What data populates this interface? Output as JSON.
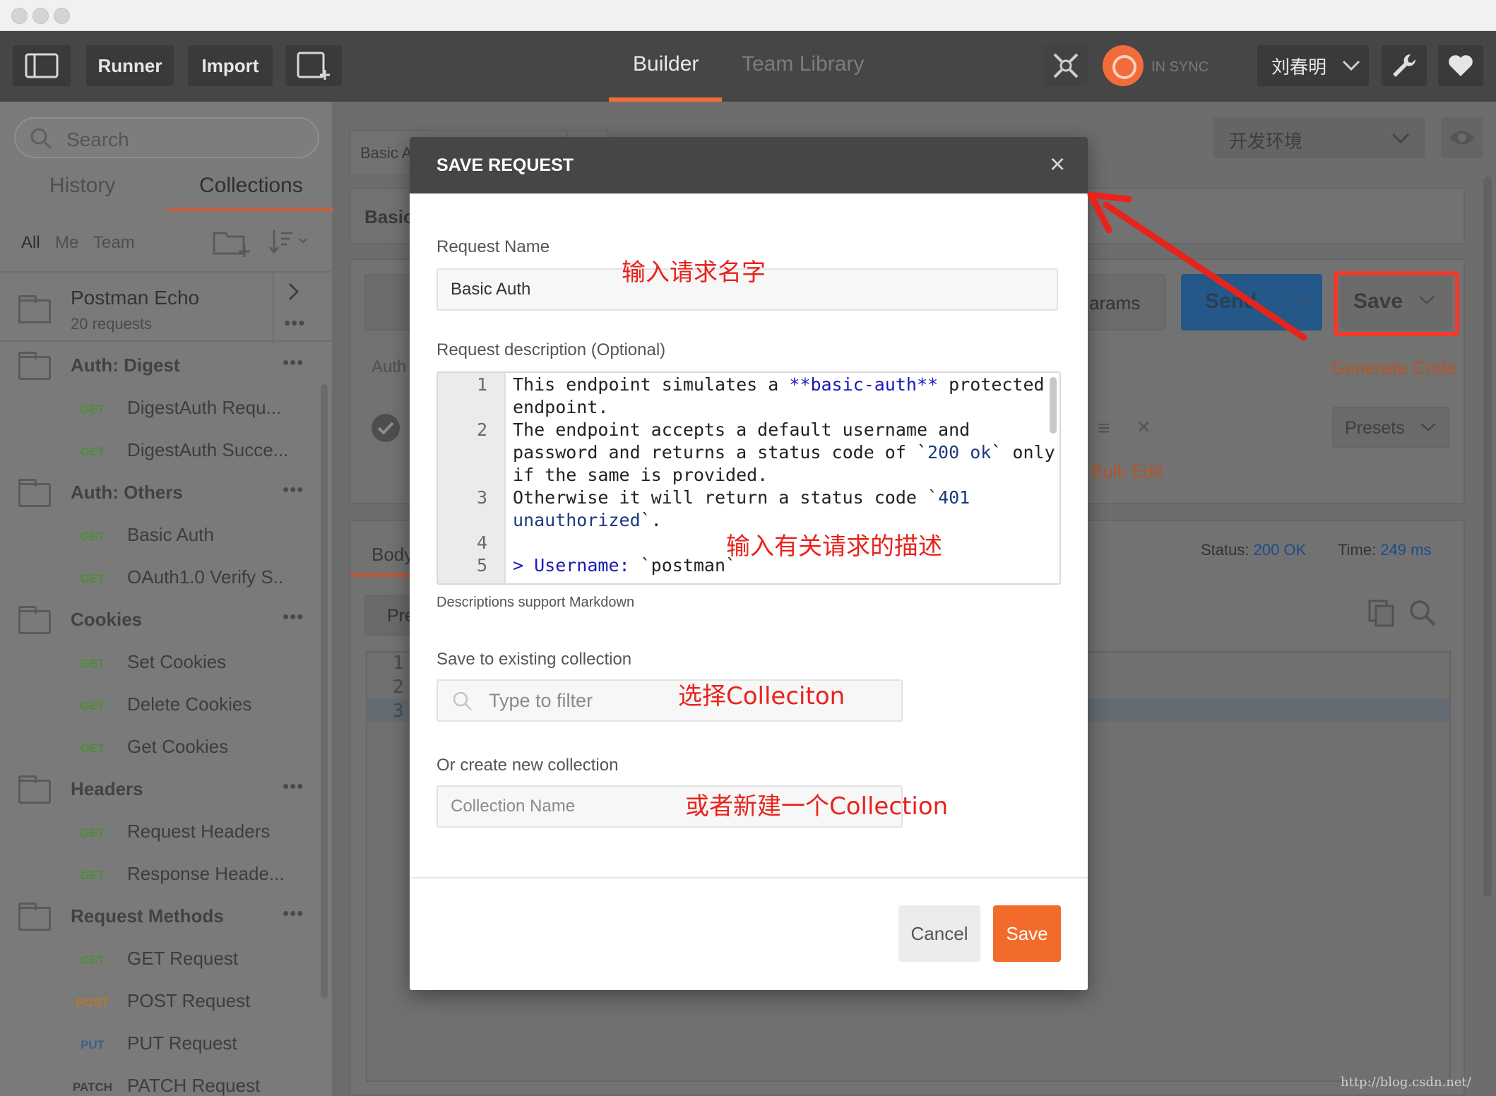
{
  "toolbar": {
    "runner_label": "Runner",
    "import_label": "Import",
    "tab_builder": "Builder",
    "tab_team_library": "Team Library",
    "sync_label": "IN SYNC",
    "user_name": "刘春明"
  },
  "sidebar": {
    "search_placeholder": "Search",
    "tab_history": "History",
    "tab_collections": "Collections",
    "filter_all": "All",
    "filter_me": "Me",
    "filter_team": "Team",
    "top_collection": {
      "name": "Postman Echo",
      "count": "20 requests"
    },
    "folders": [
      {
        "name": "Auth: Digest",
        "requests": [
          {
            "method": "GET",
            "name": "DigestAuth Requ..."
          },
          {
            "method": "GET",
            "name": "DigestAuth Succe..."
          }
        ]
      },
      {
        "name": "Auth: Others",
        "requests": [
          {
            "method": "GET",
            "name": "Basic Auth"
          },
          {
            "method": "GET",
            "name": "OAuth1.0 Verify S.."
          }
        ]
      },
      {
        "name": "Cookies",
        "requests": [
          {
            "method": "GET",
            "name": "Set Cookies"
          },
          {
            "method": "GET",
            "name": "Delete Cookies"
          },
          {
            "method": "GET",
            "name": "Get Cookies"
          }
        ]
      },
      {
        "name": "Headers",
        "requests": [
          {
            "method": "GET",
            "name": "Request Headers"
          },
          {
            "method": "GET",
            "name": "Response Heade..."
          }
        ]
      },
      {
        "name": "Request Methods",
        "requests": [
          {
            "method": "GET",
            "name": "GET Request"
          },
          {
            "method": "POST",
            "name": "POST Request"
          },
          {
            "method": "PUT",
            "name": "PUT Request"
          },
          {
            "method": "PATCH",
            "name": "PATCH Request"
          }
        ]
      }
    ]
  },
  "main": {
    "request_tab": "Basic A",
    "request_title": "Basic",
    "environment": "开发环境",
    "params_label": "arams",
    "auth_label": "Auth",
    "send_label": "Send",
    "save_label": "Save",
    "generate_code": "Generate Code",
    "presets": "Presets",
    "bulk_edit": "Bulk Edit",
    "body_label": "Body",
    "pretty_label": "Pre",
    "status_label": "Status:",
    "status_value": "200 OK",
    "time_label": "Time:",
    "time_value": "249 ms",
    "line_numbers": [
      "1",
      "2",
      "3"
    ],
    "watermark": "http://blog.csdn.net/"
  },
  "modal": {
    "title": "SAVE REQUEST",
    "close_glyph": "×",
    "request_name_label": "Request Name",
    "request_name_value": "Basic Auth",
    "description_label": "Request description (Optional)",
    "description_lines": [
      {
        "num": "1",
        "prefix": "This endpoint simulates a ",
        "bold": "**basic-auth**",
        "suffix": " protected"
      },
      {
        "num": "",
        "text": "endpoint."
      },
      {
        "num": "2",
        "text": "The endpoint accepts a default username and"
      },
      {
        "num": "",
        "prefix": "password and returns a status code of `",
        "code": "200 ok",
        "suffix": "` only"
      },
      {
        "num": "",
        "text": "if the same is provided."
      },
      {
        "num": "3",
        "prefix": "Otherwise it will return a status code `",
        "code": "401"
      },
      {
        "num": "",
        "code": "unauthorized",
        "suffix": "`."
      },
      {
        "num": "4",
        "text": ""
      },
      {
        "num": "5",
        "prefix_blue": "> Username: ",
        "suffix": "`postman`"
      }
    ],
    "description_hint": "Descriptions support Markdown",
    "existing_label": "Save to existing collection",
    "filter_placeholder": "Type to filter",
    "new_label": "Or create new collection",
    "new_placeholder": "Collection Name",
    "cancel_label": "Cancel",
    "save_label": "Save"
  },
  "annotations": {
    "name_hint": "输入请求名字",
    "desc_hint": "输入有关请求的描述",
    "collection_hint": "选择Colleciton",
    "new_collection_hint": "或者新建一个Collection"
  },
  "colors": {
    "accent": "#f26b2a",
    "annotation_red": "#e8231c",
    "toolbar_bg": "#464646"
  }
}
